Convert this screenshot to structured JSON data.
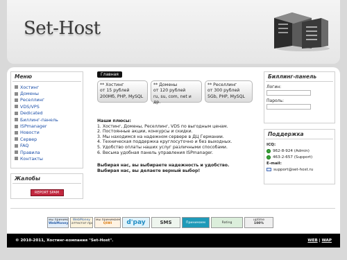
{
  "header": {
    "logo_text": "Set-Host"
  },
  "menu": {
    "title": "Меню",
    "items": [
      "Хостинг",
      "Домены",
      "Реселлинг",
      "VDS/VPS",
      "Dedicated",
      "Биллинг-панель",
      "ISPmanager",
      "Новости",
      "Сервер",
      "FAQ",
      "Правила",
      "Контакты"
    ]
  },
  "complaints": {
    "title": "Жалобы",
    "button_label": "REPORT SPAM"
  },
  "main": {
    "tag": "Главная",
    "prices": [
      {
        "l1": "** Хостинг",
        "l2": "от 15 рублей",
        "l3": "200Мб, PHP, MySQL"
      },
      {
        "l1": "** Домены",
        "l2": "от 120 рублей",
        "l3": "ru, su, com, net и др."
      },
      {
        "l1": "** Реселлинг",
        "l2": "от 300 рублей",
        "l3": "5Gb, PHP, MySQL"
      }
    ],
    "benefits_title": "Наши плюсы:",
    "benefits": [
      "1. Хостинг, Домены, Реселлинг, VDS по выгодным ценам.",
      "2. Постоянные акции, конкурсы и скидки.",
      "3. Мы находимся на надежном сервере в ДЦ Германии.",
      "4. Техническая поддержка круглосуточно и без выходных.",
      "5. Удобство оплаты наших услуг различными способами.",
      "6. Весьма удобная панель управления ISPmanager."
    ],
    "cta_1": "Выбирая нас, вы выбираете надежность и удобство.",
    "cta_2": "Выбирая нас, вы делаете верный выбор!"
  },
  "billing": {
    "title": "Биллинг-панель",
    "login_label": "Логин:",
    "password_label": "Пароль:"
  },
  "support": {
    "title": "Поддержка",
    "icq_label": "ICQ:",
    "icq_admin": "962-8-924 (Admin)",
    "icq_support": "463-2-657 (Support)",
    "email_label": "E-mail:",
    "email": "support@set-host.ru"
  },
  "badges": [
    {
      "t1": "мы принимаем",
      "t2": "WebMoney",
      "color": "#5a8fd0"
    },
    {
      "t1": "WebMoney",
      "t2": "аттестат продавца",
      "color": "#e8c56a"
    },
    {
      "t1": "мы принимаем",
      "t2": "QIWI",
      "color": "#f0a64a"
    },
    {
      "t1": "d'pay",
      "t2": "",
      "color": "#3aa2d6"
    },
    {
      "t1": "SMS",
      "t2": "",
      "color": "#3a7a3a"
    },
    {
      "t1": "Принимаем",
      "t2": "",
      "color": "#2aa6c4"
    },
    {
      "t1": "Rating",
      "t2": "",
      "color": "#3c8a3c"
    },
    {
      "t1": "uptime",
      "t2": "100%",
      "color": "#8f8f8f"
    }
  ],
  "footer": {
    "copyright": "© 2010-2011, Хостинг-компания \"Set-Host\".",
    "link_web": "WEB",
    "sep": "|",
    "link_wap": "WAP"
  }
}
